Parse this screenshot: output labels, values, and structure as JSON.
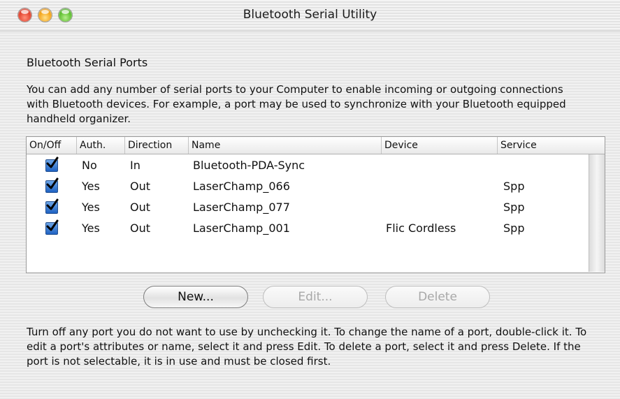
{
  "window": {
    "title": "Bluetooth Serial Utility"
  },
  "section": {
    "title": "Bluetooth Serial Ports",
    "intro": "You can add any number of serial ports to your Computer to enable incoming or outgoing connections with Bluetooth devices.  For example, a port may be used to synchronize with your Bluetooth equipped handheld organizer."
  },
  "table": {
    "columns": [
      "On/Off",
      "Auth.",
      "Direction",
      "Name",
      "Device",
      "Service"
    ],
    "rows": [
      {
        "on": true,
        "auth": "No",
        "direction": "In",
        "name": "Bluetooth-PDA-Sync",
        "device": "",
        "service": ""
      },
      {
        "on": true,
        "auth": "Yes",
        "direction": "Out",
        "name": "LaserChamp_066",
        "device": "",
        "service": "Spp"
      },
      {
        "on": true,
        "auth": "Yes",
        "direction": "Out",
        "name": "LaserChamp_077",
        "device": "",
        "service": "Spp"
      },
      {
        "on": true,
        "auth": "Yes",
        "direction": "Out",
        "name": "LaserChamp_001",
        "device": "Flic Cordless",
        "service": "Spp"
      }
    ]
  },
  "buttons": {
    "new": "New...",
    "edit": "Edit...",
    "delete": "Delete"
  },
  "help_text": "Turn off any port you do not want to use by unchecking it. To change the name of a port, double-click it. To edit a port's attributes or name, select it and press Edit. To delete a port, select it and press Delete. If the port is not selectable, it is in use and must be closed first.",
  "colors": {
    "checkbox_blue": "#1f62c2",
    "traffic_close": "#e2412c",
    "traffic_minimize": "#f4a316",
    "traffic_zoom": "#5cbe2d"
  }
}
